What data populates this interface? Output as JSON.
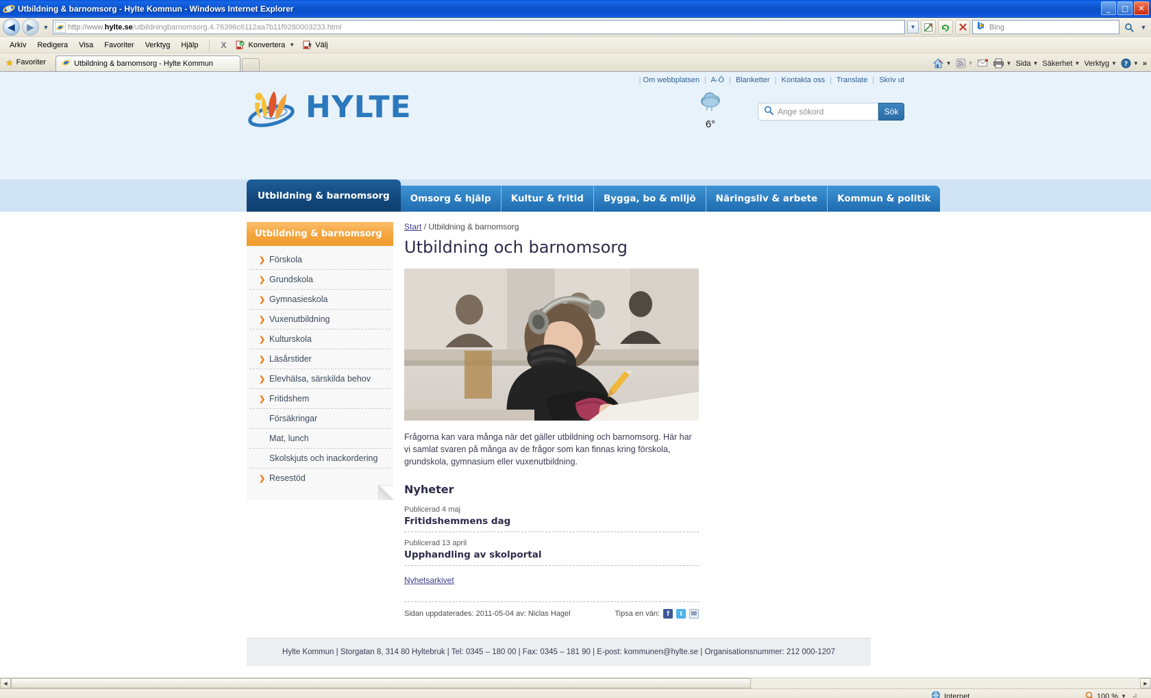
{
  "browser": {
    "window_title": "Utbildning & barnomsorg - Hylte Kommun - Windows Internet Explorer",
    "window_buttons": {
      "minimize": "_",
      "maximize": "□",
      "close": "✕"
    },
    "nav": {
      "back": "◀",
      "forward": "▶",
      "history_dropdown": "▼"
    },
    "url": {
      "protocol": "http://www.",
      "domain": "hylte.se",
      "path": "/utbildningbarnomsorg.4.76396c6112aa7b11f9280003233.html"
    },
    "address_buttons": {
      "compat_view": "compat-icon",
      "refresh": "↻",
      "stop": "✕",
      "go_dropdown": "▼"
    },
    "search": {
      "engine_label": "Bing",
      "value": ""
    },
    "menu": [
      "Arkiv",
      "Redigera",
      "Visa",
      "Favoriter",
      "Verktyg",
      "Hjälp"
    ],
    "toolbar_extra": {
      "close_x": "X",
      "convert": "Konvertera",
      "select": "Välj",
      "dropdown": "▼"
    },
    "favorites_label": "Favoriter",
    "tab_title": "Utbildning & barnomsorg - Hylte Kommun",
    "command_bar": [
      "Sida",
      "Säkerhet",
      "Verktyg"
    ],
    "command_overflow": "»",
    "status": {
      "zone": "Internet",
      "zoom": "100 %",
      "protected_mode": ""
    }
  },
  "site": {
    "util_links": [
      "Om webbplatsen",
      "A-Ö",
      "Blanketter",
      "Kontakta oss",
      "Translate",
      "Skriv ut"
    ],
    "logo_text": "HYLTE",
    "weather": {
      "temperature": "6°",
      "icon": "rain-cloud-icon"
    },
    "search": {
      "placeholder": "Ange sökord",
      "button_label": "Sök",
      "value": ""
    },
    "mainnav": [
      {
        "label": "Utbildning & barnomsorg",
        "active": true
      },
      {
        "label": "Omsorg & hjälp",
        "active": false
      },
      {
        "label": "Kultur & fritid",
        "active": false
      },
      {
        "label": "Bygga, bo & miljö",
        "active": false
      },
      {
        "label": "Näringsliv & arbete",
        "active": false
      },
      {
        "label": "Kommun & politik",
        "active": false
      }
    ],
    "sidebar": {
      "heading": "Utbildning & barnomsorg",
      "items": [
        {
          "label": "Förskola",
          "arrow": true
        },
        {
          "label": "Grundskola",
          "arrow": true
        },
        {
          "label": "Gymnasieskola",
          "arrow": true
        },
        {
          "label": "Vuxenutbildning",
          "arrow": true
        },
        {
          "label": "Kulturskola",
          "arrow": true
        },
        {
          "label": "Läsårstider",
          "arrow": true
        },
        {
          "label": "Elevhälsa, särskilda behov",
          "arrow": true
        },
        {
          "label": "Fritidshem",
          "arrow": true
        },
        {
          "label": "Försäkringar",
          "arrow": false
        },
        {
          "label": "Mat, lunch",
          "arrow": false
        },
        {
          "label": "Skolskjuts och inackordering",
          "arrow": false
        },
        {
          "label": "Resestöd",
          "arrow": true
        }
      ]
    },
    "breadcrumb": {
      "home": "Start",
      "separator": "/",
      "current": "Utbildning & barnomsorg"
    },
    "page_title": "Utbildning och barnomsorg",
    "hero_alt": "Flicka med hörlurar som skriver vid skolbänk",
    "intro": "Frågorna kan vara många när det gäller utbildning och barnomsorg. Här har vi samlat svaren på många av de frågor som kan finnas kring förskola, grundskola, gymnasium eller vuxenutbildning.",
    "news_heading": "Nyheter",
    "news": [
      {
        "date": "Publicerad 4 maj",
        "title": "Fritidshemmens dag"
      },
      {
        "date": "Publicerad 13 april",
        "title": "Upphandling av skolportal"
      }
    ],
    "news_archive_link": "Nyhetsarkivet",
    "meta": {
      "updated": "Sidan uppdaterades: 2011-05-04  av: Niclas Hagel",
      "share_label": "Tipsa en vän:",
      "share_icons": [
        "facebook-icon",
        "twitter-icon",
        "email-icon"
      ]
    },
    "footer": "Hylte Kommun | Storgatan 8, 314 80 Hyltebruk | Tel: 0345 – 180 00 | Fax: 0345 – 181 90 | E-post: kommunen@hylte.se | Organisationsnummer: 212 000-1207"
  },
  "colors": {
    "brand_blue": "#2b78bd",
    "nav_active": "#12487c",
    "accent_orange": "#f4a63f",
    "menu_arrow": "#e8821e",
    "page_bg_top": "#e8f2fb",
    "nav_band": "#cfe3f5"
  }
}
